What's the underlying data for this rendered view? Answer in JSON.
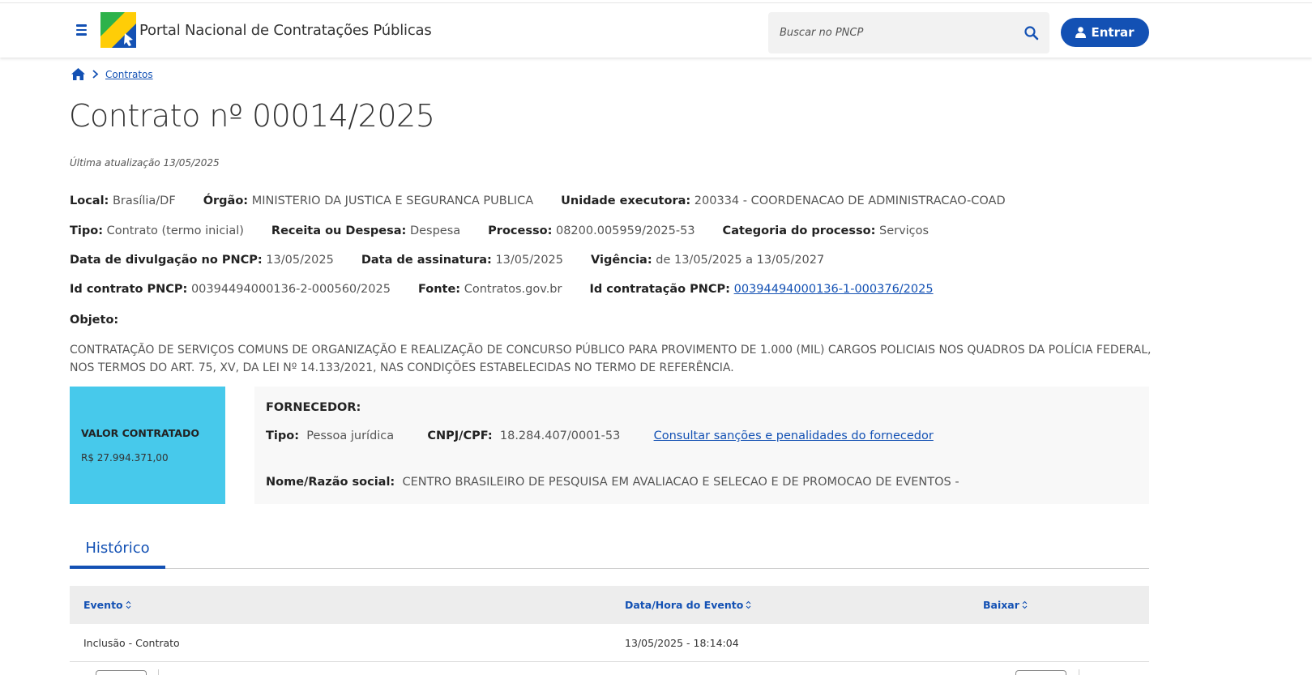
{
  "header": {
    "portal_title": "Portal Nacional de Contratações Públicas",
    "search_placeholder": "Buscar no PNCP",
    "login_label": "Entrar"
  },
  "breadcrumb": {
    "link": "Contratos"
  },
  "contract": {
    "title": "Contrato nº 00014/2025",
    "updated": "Última atualização 13/05/2025",
    "rows": [
      [
        {
          "label": "Local:",
          "value": "Brasília/DF"
        },
        {
          "label": "Órgão:",
          "value": "MINISTERIO DA JUSTICA E SEGURANCA PUBLICA"
        },
        {
          "label": "Unidade executora:",
          "value": "200334 - COORDENACAO DE ADMINISTRACAO-COAD"
        }
      ],
      [
        {
          "label": "Tipo:",
          "value": "Contrato (termo inicial)"
        },
        {
          "label": "Receita ou Despesa:",
          "value": "Despesa"
        },
        {
          "label": "Processo:",
          "value": "08200.005959/2025-53"
        },
        {
          "label": "Categoria do processo:",
          "value": "Serviços"
        }
      ],
      [
        {
          "label": "Data de divulgação no PNCP:",
          "value": "13/05/2025"
        },
        {
          "label": "Data de assinatura:",
          "value": "13/05/2025"
        },
        {
          "label": "Vigência:",
          "value": "de 13/05/2025 a 13/05/2027"
        }
      ],
      [
        {
          "label": "Id contrato PNCP:",
          "value": "00394494000136-2-000560/2025"
        },
        {
          "label": "Fonte:",
          "value": "Contratos.gov.br"
        },
        {
          "label": "Id contratação PNCP:",
          "value": "00394494000136-1-000376/2025"
        }
      ]
    ],
    "objeto_label": "Objeto:",
    "objeto_text": "CONTRATAÇÃO DE SERVIÇOS COMUNS DE ORGANIZAÇÃO E REALIZAÇÃO DE CONCURSO PÚBLICO PARA PROVIMENTO DE 1.000 (MIL) CARGOS POLICIAIS NOS QUADROS DA POLÍCIA FEDERAL, NOS TERMOS DO ART. 75, XV, DA LEI Nº 14.133/2021, NAS CONDIÇÕES ESTABELECIDAS NO TERMO DE REFERÊNCIA."
  },
  "valor": {
    "label": "VALOR CONTRATADO",
    "value": "R$ 27.994.371,00"
  },
  "fornecedor": {
    "title": "FORNECEDOR:",
    "tipo_label": "Tipo:",
    "tipo_value": "Pessoa jurídica",
    "cnpj_label": "CNPJ/CPF:",
    "cnpj_value": "18.284.407/0001-53",
    "sancoes_link": "Consultar sanções e penalidades do fornecedor",
    "nome_label": "Nome/Razão social:",
    "nome_value": "CENTRO BRASILEIRO DE PESQUISA EM AVALIACAO E SELECAO E DE PROMOCAO DE EVENTOS -"
  },
  "tabs": {
    "active": "Histórico"
  },
  "table": {
    "columns": [
      "Evento",
      "Data/Hora do Evento",
      "Baixar"
    ],
    "rows": [
      {
        "evento": "Inclusão - Contrato",
        "data": "13/05/2025 - 18:14:04",
        "baixar": ""
      }
    ]
  },
  "colors": {
    "primary": "#1351b4",
    "valor_bg": "#47c9eb"
  }
}
